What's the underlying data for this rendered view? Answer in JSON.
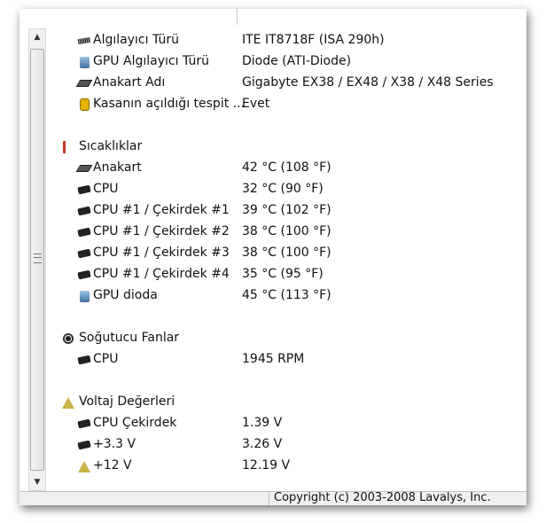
{
  "rows": [
    {
      "label": "Algılayıcı Türü",
      "value": "ITE IT8718F  (ISA 290h)",
      "icon": "sensor-icon"
    },
    {
      "label": "GPU Algılayıcı Türü",
      "value": "Diode  (ATI-Diode)",
      "icon": "gpu-icon"
    },
    {
      "label": "Anakart Adı",
      "value": "Gigabyte EX38 / EX48 / X38 / X48 Series",
      "icon": "motherboard-icon"
    },
    {
      "label": "Kasanın açıldığı tespit ...",
      "value": "Evet",
      "icon": "lock-icon"
    },
    {
      "label": "Sıcaklıklar",
      "icon": "thermometer-icon"
    },
    {
      "label": "Anakart",
      "value": "42 °C  (108 °F)",
      "icon": "motherboard-icon"
    },
    {
      "label": "CPU",
      "value": "32 °C  (90 °F)",
      "icon": "cpu-icon"
    },
    {
      "label": "CPU #1 / Çekirdek #1",
      "value": "39 °C  (102 °F)",
      "icon": "cpu-icon"
    },
    {
      "label": "CPU #1 / Çekirdek #2",
      "value": "38 °C  (100 °F)",
      "icon": "cpu-icon"
    },
    {
      "label": "CPU #1 / Çekirdek #3",
      "value": "38 °C  (100 °F)",
      "icon": "cpu-icon"
    },
    {
      "label": "CPU #1 / Çekirdek #4",
      "value": "35 °C  (95 °F)",
      "icon": "cpu-icon"
    },
    {
      "label": "GPU dioda",
      "value": "45 °C  (113 °F)",
      "icon": "gpu-icon"
    },
    {
      "label": "Soğutucu Fanlar",
      "icon": "fan-icon"
    },
    {
      "label": "CPU",
      "value": "1945 RPM",
      "icon": "cpu-icon"
    },
    {
      "label": "Voltaj Değerleri",
      "icon": "voltage-warning-icon"
    },
    {
      "label": "CPU Çekirdek",
      "value": "1.39 V",
      "icon": "cpu-icon"
    },
    {
      "label": "+3.3 V",
      "value": "3.26 V",
      "icon": "cpu-icon"
    },
    {
      "label": "+12 V",
      "value": "12.19 V",
      "icon": "voltage-warning-icon"
    }
  ],
  "status": {
    "copyright": "Copyright (c) 2003-2008 Lavalys, Inc."
  }
}
